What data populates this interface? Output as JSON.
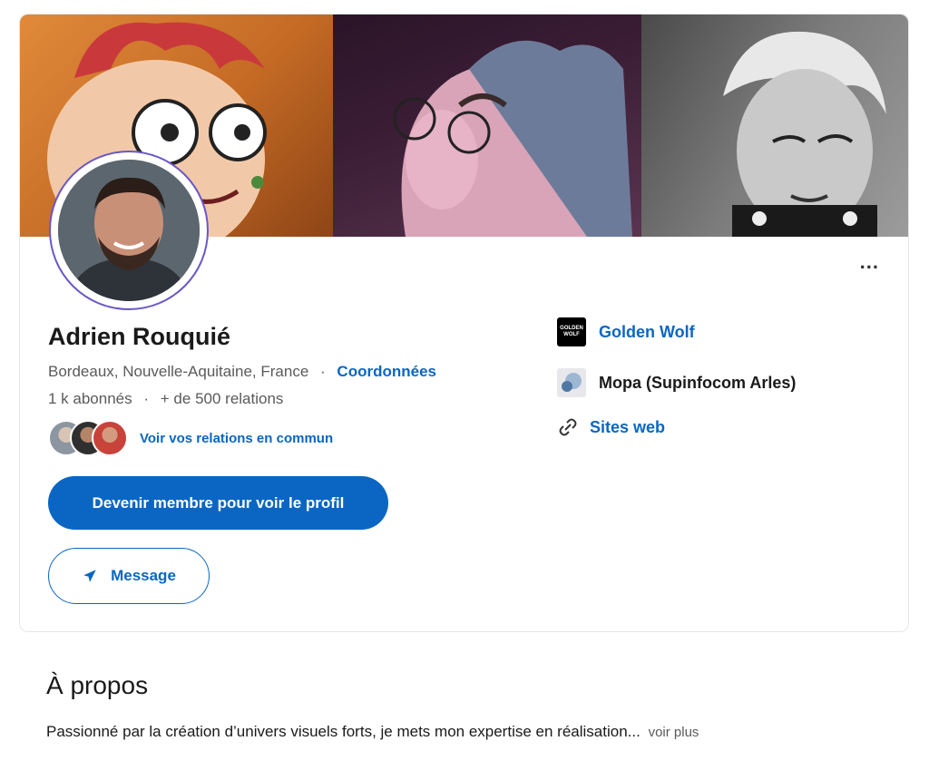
{
  "profile": {
    "name": "Adrien Rouquié",
    "location": "Bordeaux, Nouvelle-Aquitaine, France",
    "separator": "·",
    "contact_link": "Coordonnées",
    "followers": "1 k abonnés",
    "connections": "+ de 500 relations",
    "stats_separator": "·",
    "mutual_link": "Voir vos relations en commun",
    "more_label": "...",
    "join_button": "Devenir membre pour voir le profil",
    "message_button": "Message"
  },
  "sidebar": {
    "company": "Golden Wolf",
    "company_logo_text": "GOLDEN WOLF",
    "school": "Mopa (Supinfocom Arles)",
    "websites": "Sites web"
  },
  "about": {
    "title": "À propos",
    "text": "Passionné par la création d’univers visuels forts, je mets mon expertise en réalisation...",
    "more_label": "voir plus"
  },
  "colors": {
    "accent": "#0a66c2",
    "avatar_ring": "#6b57c7"
  }
}
